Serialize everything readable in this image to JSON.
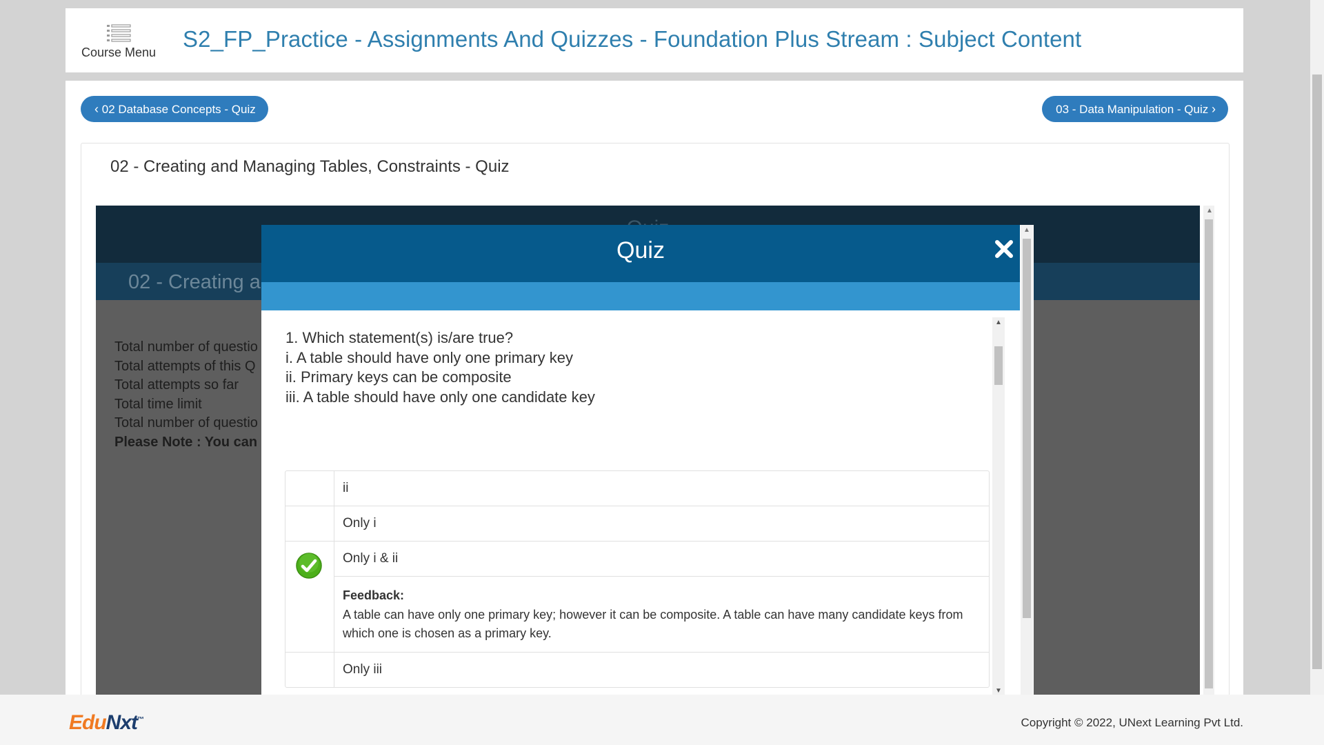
{
  "header": {
    "course_menu_label": "Course Menu",
    "title": "S2_FP_Practice - Assignments And Quizzes - Foundation Plus Stream : Subject Content"
  },
  "nav": {
    "prev_label": "02 Database Concepts - Quiz",
    "next_label": "03 - Data Manipulation - Quiz"
  },
  "card": {
    "title": "02 - Creating and Managing Tables, Constraints - Quiz"
  },
  "frame": {
    "top_title": "Quiz",
    "sub_title": "02 - Creating ar",
    "info": [
      "Total number of questio",
      "Total attempts of this Q",
      "Total attempts so far",
      "Total time limit",
      "Total number of questio"
    ],
    "note": "Please Note : You can"
  },
  "modal": {
    "title": "Quiz",
    "question_lines": [
      "1. Which statement(s) is/are true?",
      "i. A table should have only one primary key",
      "ii. Primary keys can be composite",
      "iii. A table should have only one candidate key"
    ],
    "options": [
      "ii",
      "Only i",
      "Only i & ii",
      "Only iii"
    ],
    "selected_option_index": 2,
    "feedback_label": "Feedback:",
    "feedback_text": "A table can have only one primary key; however it can be composite. A table can have many candidate keys from which one is chosen as a primary key."
  },
  "footer": {
    "logo_edu": "Edu",
    "logo_nxt": "Nxt",
    "logo_tm": "™",
    "copyright": "Copyright © 2022, UNext Learning Pvt Ltd."
  },
  "colors": {
    "title_blue": "#2f7fae",
    "nav_button": "#2f7cbd",
    "modal_header": "#065a8c",
    "modal_band": "#3395cf",
    "check_green": "#4caf1a",
    "logo_orange": "#f07a22",
    "logo_navy": "#1d3e6e"
  },
  "icons": {
    "menu": "list-menu-icon",
    "close": "close-x-icon",
    "correct": "green-check-circle-icon"
  }
}
